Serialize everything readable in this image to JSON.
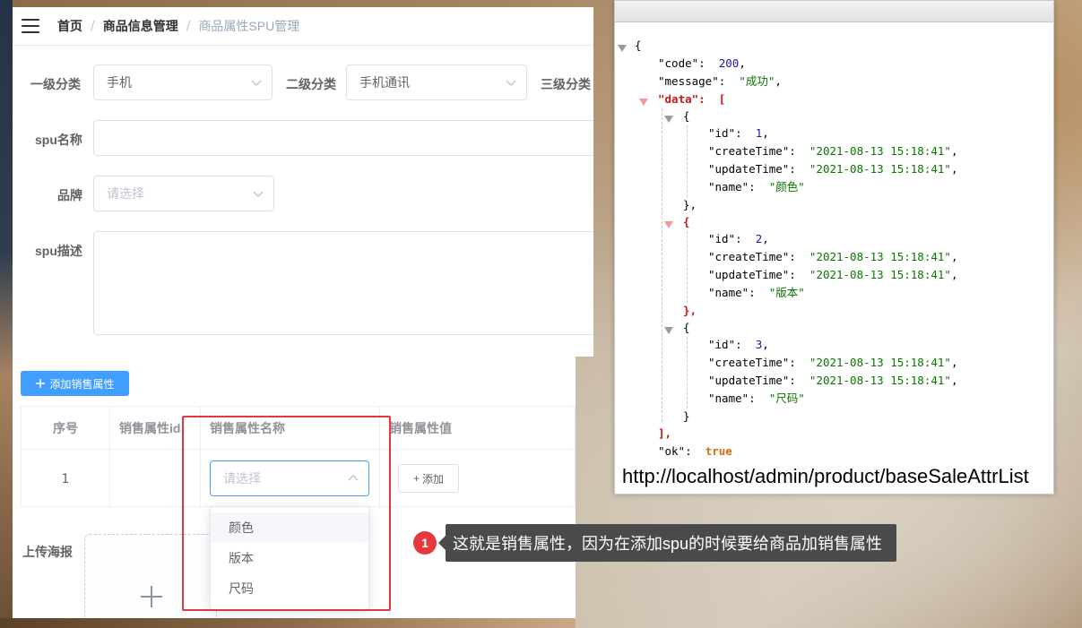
{
  "header": {
    "breadcrumb": [
      "首页",
      "商品信息管理",
      "商品属性SPU管理"
    ],
    "breadcrumb_sep": "/"
  },
  "form": {
    "category1_label": "一级分类",
    "category1_value": "手机",
    "category2_label": "二级分类",
    "category2_value": "手机通讯",
    "category3_label": "三级分类",
    "spu_name_label": "spu名称",
    "spu_name_value": "",
    "brand_label": "品牌",
    "brand_placeholder": "请选择",
    "spu_desc_label": "spu描述",
    "spu_desc_value": ""
  },
  "sale_attr": {
    "add_button": "添加销售属性",
    "columns": [
      "序号",
      "销售属性id",
      "销售属性名称",
      "销售属性值"
    ],
    "row": {
      "index": "1",
      "id": "",
      "name_placeholder": "请选择",
      "add_value_button": "添加"
    },
    "options": [
      "颜色",
      "版本",
      "尺码"
    ],
    "hovered_option": "颜色"
  },
  "upload": {
    "label": "上传海报"
  },
  "annotation": {
    "number": "1",
    "text": "这就是销售属性，因为在添加spu的时候要给商品加销售属性"
  },
  "json_viewer": {
    "url": "http://localhost/admin/product/baseSaleAttrList",
    "code_key": "\"code\"",
    "code_value": "200",
    "message_key": "\"message\"",
    "message_value": "\"成功\"",
    "data_key": "\"data\"",
    "ok_key": "\"ok\"",
    "ok_value": "true",
    "items": [
      {
        "id": "1",
        "createTime": "\"2021-08-13 15:18:41\"",
        "updateTime": "\"2021-08-13 15:18:41\"",
        "name": "\"颜色\""
      },
      {
        "id": "2",
        "createTime": "\"2021-08-13 15:18:41\"",
        "updateTime": "\"2021-08-13 15:18:41\"",
        "name": "\"版本\""
      },
      {
        "id": "3",
        "createTime": "\"2021-08-13 15:18:41\"",
        "updateTime": "\"2021-08-13 15:18:41\"",
        "name": "\"尺码\""
      }
    ]
  },
  "colors": {
    "primary": "#409eff",
    "highlight_red": "#e0393e",
    "annotation_bg": "#4a4a4a",
    "json_number": "#1a1aa6",
    "json_string": "#0b7500",
    "json_bool": "#d4700c"
  }
}
